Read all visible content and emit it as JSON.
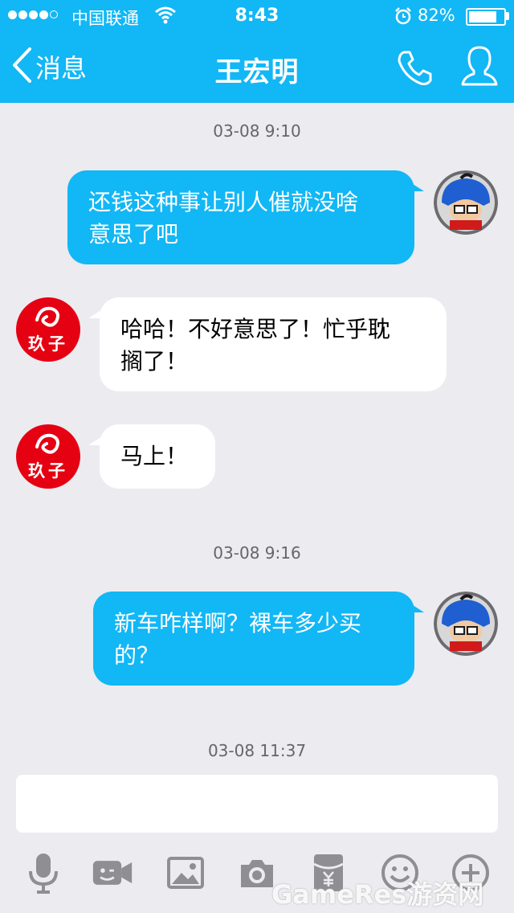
{
  "status_bar": {
    "carrier": "中国联通",
    "time": "8:43",
    "battery_percent": "82%",
    "battery_level": 0.82,
    "signal_bars_filled": 4,
    "signal_bars_total": 5
  },
  "nav": {
    "back_label": "消息",
    "title": "王宏明"
  },
  "messages": [
    {
      "timestamp": "03-08 9:10"
    },
    {
      "side": "outgoing",
      "line1": "还钱这种事让别人催就没啥",
      "line2": "意思了吧"
    },
    {
      "side": "incoming",
      "line1": "哈哈！不好意思了！忙乎耽",
      "line2": "搁了！"
    },
    {
      "side": "incoming",
      "line1": "马上！"
    },
    {
      "timestamp": "03-08 9:16"
    },
    {
      "side": "outgoing",
      "line1": "新车咋样啊？裸车多少买",
      "line2": "的？"
    },
    {
      "timestamp": "03-08 11:37"
    }
  ],
  "contact_avatar_text": "玖子",
  "watermark": "GameRes游资网",
  "toolbar": [
    "microphone-icon",
    "video-icon",
    "image-icon",
    "camera-icon",
    "red-packet-icon",
    "emoji-icon",
    "plus-icon"
  ],
  "colors": {
    "accent": "#12b7f5",
    "background": "#ebebf0",
    "avatar_red": "#e50012",
    "icon_gray": "#8e8e93"
  }
}
